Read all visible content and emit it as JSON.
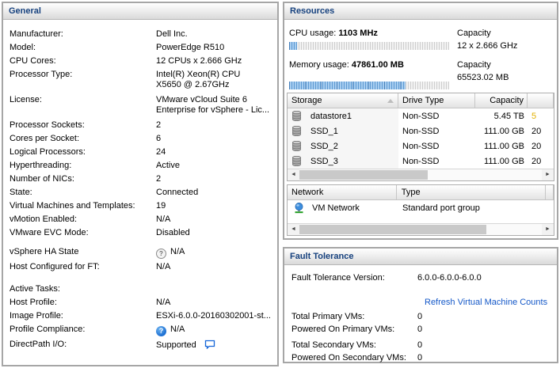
{
  "colors": {
    "header_text": "#16417e",
    "link": "#1458c8",
    "bar_fill": "#7fb2e4",
    "warning_text": "#e3b100"
  },
  "panels": {
    "general": {
      "title": "General",
      "rows": [
        {
          "label": "Manufacturer:",
          "value": "Dell Inc."
        },
        {
          "label": "Model:",
          "value": "PowerEdge R510"
        },
        {
          "label": "CPU Cores:",
          "value": "12 CPUs x 2.666 GHz"
        },
        {
          "label": "Processor Type:",
          "value": "Intel(R) Xeon(R) CPU\nX5650  @ 2.67GHz"
        },
        {
          "label": "License:",
          "value": "VMware vCloud Suite 6\nEnterprise for vSphere - Lic..."
        },
        {
          "label": "Processor Sockets:",
          "value": "2"
        },
        {
          "label": "Cores per Socket:",
          "value": "6"
        },
        {
          "label": "Logical Processors:",
          "value": "24"
        },
        {
          "label": "Hyperthreading:",
          "value": "Active"
        },
        {
          "label": "Number of NICs:",
          "value": "2"
        },
        {
          "label": "State:",
          "value": "Connected"
        },
        {
          "label": "Virtual Machines and Templates:",
          "value": "19"
        },
        {
          "label": "vMotion Enabled:",
          "value": "N/A"
        },
        {
          "label": "VMware EVC Mode:",
          "value": "Disabled"
        },
        {
          "label": "vSphere HA State",
          "value": "N/A",
          "icon": "help-gray-icon"
        },
        {
          "label": "Host Configured for FT:",
          "value": "N/A"
        },
        {
          "label": "Active Tasks:",
          "value": ""
        },
        {
          "label": "Host Profile:",
          "value": "N/A"
        },
        {
          "label": "Image Profile:",
          "value": "ESXi-6.0.0-20160302001-st..."
        },
        {
          "label": "Profile Compliance:",
          "value": "N/A",
          "icon": "help-blue-icon"
        },
        {
          "label": "DirectPath I/O:",
          "value": "Supported",
          "icon": "comment-icon"
        }
      ]
    },
    "resources": {
      "title": "Resources",
      "cpu": {
        "label": "CPU usage:",
        "value": "1103 MHz",
        "capacity_label": "Capacity",
        "capacity": "12 x 2.666 GHz",
        "percent": 5
      },
      "memory": {
        "label": "Memory usage:",
        "value": "47861.00 MB",
        "capacity_label": "Capacity",
        "capacity": "65523.02 MB",
        "percent": 73
      },
      "storage_table": {
        "columns": [
          "Storage",
          "Drive Type",
          "Capacity"
        ],
        "sort_icon": "sort-ascending-icon",
        "row_icon": "datastore-icon",
        "rows": [
          {
            "name": "datastore1",
            "drive_type": "Non-SSD",
            "capacity": "5.45 TB",
            "free_clipped": "5"
          },
          {
            "name": "SSD_1",
            "drive_type": "Non-SSD",
            "capacity": "111.00 GB",
            "free_clipped": "20"
          },
          {
            "name": "SSD_2",
            "drive_type": "Non-SSD",
            "capacity": "111.00 GB",
            "free_clipped": "20"
          },
          {
            "name": "SSD_3",
            "drive_type": "Non-SSD",
            "capacity": "111.00 GB",
            "free_clipped": "20"
          }
        ]
      },
      "network_table": {
        "columns": [
          "Network",
          "Type"
        ],
        "row_icon": "network-icon",
        "rows": [
          {
            "name": "VM Network",
            "type": "Standard port group"
          }
        ]
      }
    },
    "fault_tolerance": {
      "title": "Fault Tolerance",
      "version_label": "Fault Tolerance Version:",
      "version_value": "6.0.0-6.0.0-6.0.0",
      "link_label": "Refresh Virtual Machine Counts",
      "counts": [
        {
          "label": "Total Primary VMs:",
          "value": "0"
        },
        {
          "label": "Powered On Primary VMs:",
          "value": "0"
        },
        {
          "label": "Total Secondary VMs:",
          "value": "0"
        },
        {
          "label": "Powered On Secondary VMs:",
          "value": "0"
        }
      ]
    }
  }
}
